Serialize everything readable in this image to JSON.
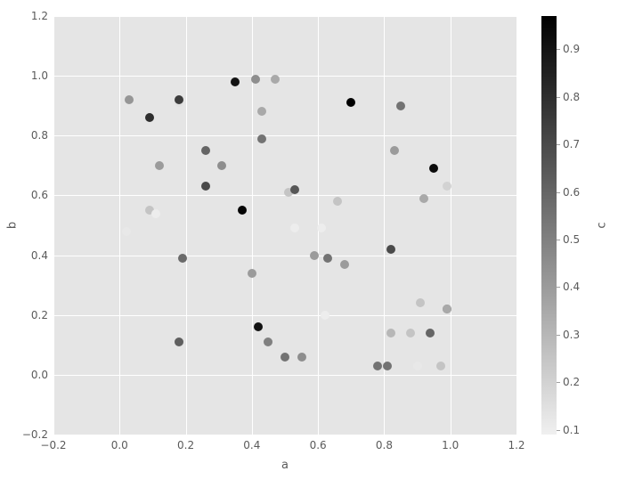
{
  "chart_data": {
    "type": "scatter",
    "title": "",
    "xlabel": "a",
    "ylabel": "b",
    "cbar_label": "c",
    "xlim": [
      -0.2,
      1.2
    ],
    "ylim": [
      -0.2,
      1.2
    ],
    "clim": [
      0.09,
      0.97
    ],
    "x_ticks": [
      -0.2,
      0.0,
      0.2,
      0.4,
      0.6,
      0.8,
      1.0,
      1.2
    ],
    "y_ticks": [
      -0.2,
      0.0,
      0.2,
      0.4,
      0.6,
      0.8,
      1.0,
      1.2
    ],
    "cbar_ticks": [
      0.1,
      0.2,
      0.3,
      0.4,
      0.5,
      0.6,
      0.7,
      0.8,
      0.9
    ],
    "points": [
      {
        "x": 0.02,
        "y": 0.48,
        "c": 0.12
      },
      {
        "x": 0.03,
        "y": 0.92,
        "c": 0.42
      },
      {
        "x": 0.09,
        "y": 0.55,
        "c": 0.25
      },
      {
        "x": 0.09,
        "y": 0.86,
        "c": 0.8
      },
      {
        "x": 0.11,
        "y": 0.54,
        "c": 0.1
      },
      {
        "x": 0.12,
        "y": 0.7,
        "c": 0.4
      },
      {
        "x": 0.18,
        "y": 0.11,
        "c": 0.62
      },
      {
        "x": 0.18,
        "y": 0.91,
        "c": 0.15
      },
      {
        "x": 0.18,
        "y": 0.92,
        "c": 0.75
      },
      {
        "x": 0.19,
        "y": 0.39,
        "c": 0.58
      },
      {
        "x": 0.26,
        "y": 0.63,
        "c": 0.7
      },
      {
        "x": 0.26,
        "y": 0.75,
        "c": 0.6
      },
      {
        "x": 0.31,
        "y": 0.7,
        "c": 0.45
      },
      {
        "x": 0.35,
        "y": 0.98,
        "c": 0.9
      },
      {
        "x": 0.37,
        "y": 0.55,
        "c": 0.95
      },
      {
        "x": 0.4,
        "y": 0.34,
        "c": 0.4
      },
      {
        "x": 0.41,
        "y": 0.99,
        "c": 0.45
      },
      {
        "x": 0.42,
        "y": 0.16,
        "c": 0.9
      },
      {
        "x": 0.43,
        "y": 0.79,
        "c": 0.55
      },
      {
        "x": 0.43,
        "y": 0.88,
        "c": 0.35
      },
      {
        "x": 0.45,
        "y": 0.11,
        "c": 0.5
      },
      {
        "x": 0.47,
        "y": 0.99,
        "c": 0.35
      },
      {
        "x": 0.5,
        "y": 0.06,
        "c": 0.55
      },
      {
        "x": 0.51,
        "y": 0.61,
        "c": 0.25
      },
      {
        "x": 0.53,
        "y": 0.49,
        "c": 0.1
      },
      {
        "x": 0.53,
        "y": 0.62,
        "c": 0.65
      },
      {
        "x": 0.55,
        "y": 0.06,
        "c": 0.45
      },
      {
        "x": 0.59,
        "y": 0.4,
        "c": 0.4
      },
      {
        "x": 0.61,
        "y": 0.49,
        "c": 0.1
      },
      {
        "x": 0.62,
        "y": 0.2,
        "c": 0.1
      },
      {
        "x": 0.63,
        "y": 0.39,
        "c": 0.55
      },
      {
        "x": 0.66,
        "y": 0.58,
        "c": 0.25
      },
      {
        "x": 0.68,
        "y": 0.37,
        "c": 0.4
      },
      {
        "x": 0.7,
        "y": 0.91,
        "c": 0.97
      },
      {
        "x": 0.78,
        "y": 0.03,
        "c": 0.55
      },
      {
        "x": 0.81,
        "y": 0.03,
        "c": 0.55
      },
      {
        "x": 0.82,
        "y": 0.14,
        "c": 0.3
      },
      {
        "x": 0.82,
        "y": 0.42,
        "c": 0.7
      },
      {
        "x": 0.83,
        "y": 0.75,
        "c": 0.4
      },
      {
        "x": 0.85,
        "y": 0.9,
        "c": 0.55
      },
      {
        "x": 0.88,
        "y": 0.14,
        "c": 0.25
      },
      {
        "x": 0.9,
        "y": 0.03,
        "c": 0.12
      },
      {
        "x": 0.91,
        "y": 0.24,
        "c": 0.25
      },
      {
        "x": 0.92,
        "y": 0.59,
        "c": 0.35
      },
      {
        "x": 0.94,
        "y": 0.14,
        "c": 0.6
      },
      {
        "x": 0.95,
        "y": 0.69,
        "c": 0.93
      },
      {
        "x": 0.97,
        "y": 0.03,
        "c": 0.25
      },
      {
        "x": 0.99,
        "y": 0.22,
        "c": 0.55
      },
      {
        "x": 0.99,
        "y": 0.22,
        "c": 0.35
      },
      {
        "x": 0.99,
        "y": 0.63,
        "c": 0.2
      }
    ]
  }
}
